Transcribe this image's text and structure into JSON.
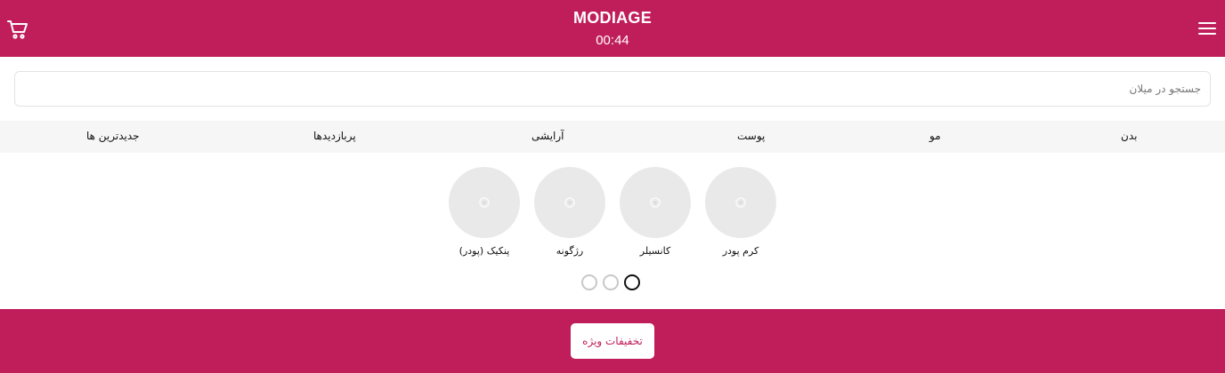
{
  "header": {
    "brand": "MODIAGE",
    "timer": "00:44",
    "cart_icon": "shopping-cart-icon",
    "menu_icon": "hamburger-menu-icon",
    "background_color": "#c01e5a"
  },
  "search": {
    "placeholder": "جستجو در میلان",
    "value": ""
  },
  "categories": [
    {
      "label": "بدن"
    },
    {
      "label": "مو"
    },
    {
      "label": "پوست"
    },
    {
      "label": "آرایشی"
    },
    {
      "label": "پربازدیدها"
    },
    {
      "label": "جدیدترین ها"
    }
  ],
  "subcategories": [
    {
      "label": "کرم پودر",
      "icon": "image-placeholder-icon"
    },
    {
      "label": "کانسیلر",
      "icon": "image-placeholder-icon"
    },
    {
      "label": "رژگونه",
      "icon": "image-placeholder-icon"
    },
    {
      "label": "پنکیک (پودر)",
      "icon": "image-placeholder-icon"
    }
  ],
  "pagination": {
    "total": 3,
    "active_index": 0
  },
  "footer": {
    "deals_label": "تخفیفات ویژه",
    "background_color": "#c01e5a"
  }
}
